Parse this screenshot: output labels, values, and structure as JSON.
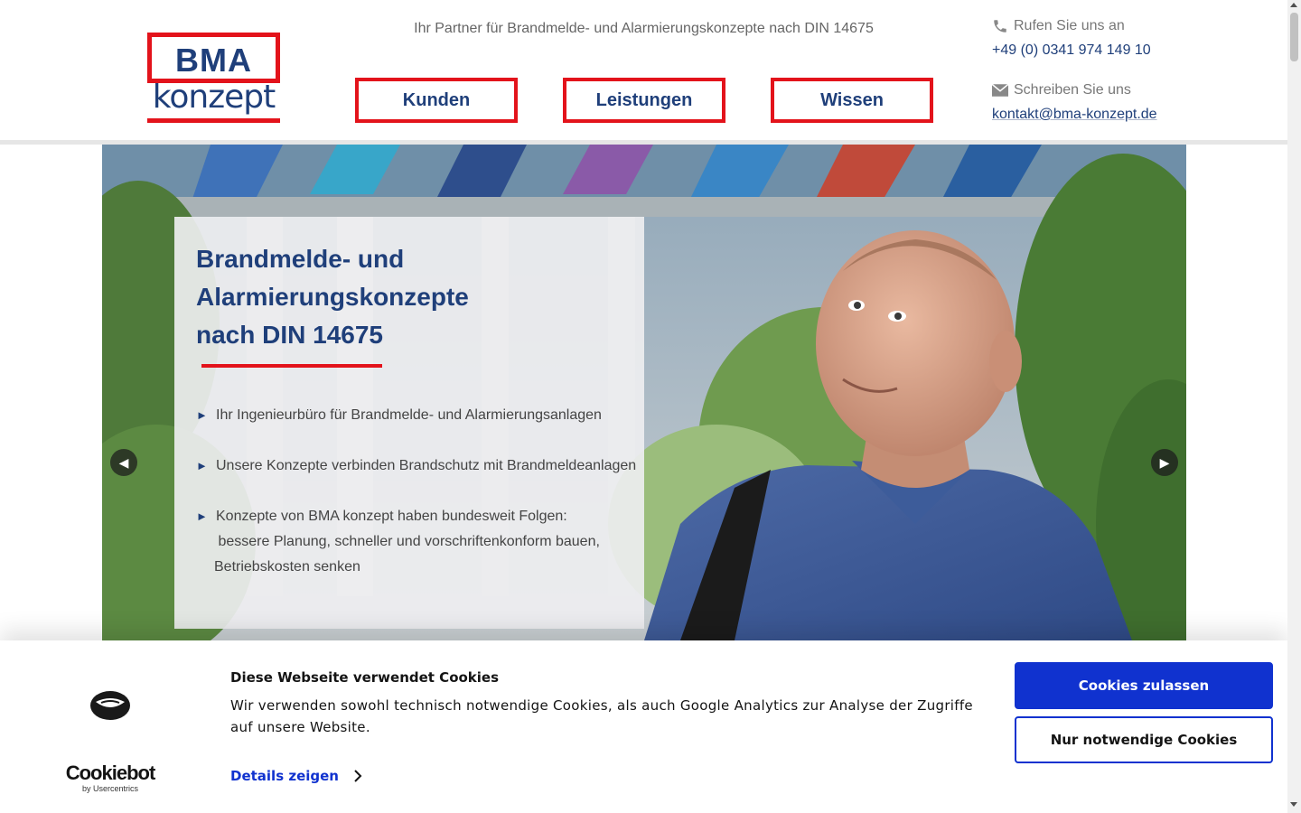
{
  "header": {
    "logo_top": "BMA",
    "logo_bottom": "konzept",
    "tagline": "Ihr Partner für Brandmelde- und Alarmierungskonzepte nach DIN 14675",
    "nav": [
      {
        "label": "Kunden"
      },
      {
        "label": "Leistungen"
      },
      {
        "label": "Wissen"
      }
    ],
    "contact": {
      "phone_label": "Rufen Sie uns an",
      "phone": "+49 (0) 0341 974 149 10",
      "email_label": "Schreiben Sie uns",
      "email": "kontakt@bma-konzept.de"
    }
  },
  "hero": {
    "title_lines": [
      "Brandmelde- und",
      "Alarmierungskonzepte",
      "nach DIN 14675"
    ],
    "bullets": [
      "Ihr Ingenieurbüro für Brandmelde- und Alarmierungsanlagen",
      "Unsere Konzepte verbinden Brandschutz mit Brandmeldeanlagen"
    ],
    "bullet3_lines": [
      "Konzepte von BMA konzept haben bundesweit Folgen:",
      " bessere Planung, schneller und vorschriftenkonform bauen,",
      "Betriebskosten senken"
    ],
    "bullet_arrow": "►",
    "prev": "◀",
    "next": "▶"
  },
  "cookie": {
    "title": "Diese Webseite verwendet Cookies",
    "text": "Wir verwenden sowohl technisch notwendige Cookies, als auch Google Analytics zur Analyse der Zugriffe auf unsere Website.",
    "details": "Details zeigen",
    "allow": "Cookies zulassen",
    "necessary": "Nur notwendige Cookies",
    "brand": "Cookiebot",
    "brand_sub": "by Usercentrics"
  },
  "colors": {
    "brand_blue": "#1f3f7a",
    "brand_red": "#e3131b",
    "cookie_blue": "#1032cf"
  }
}
